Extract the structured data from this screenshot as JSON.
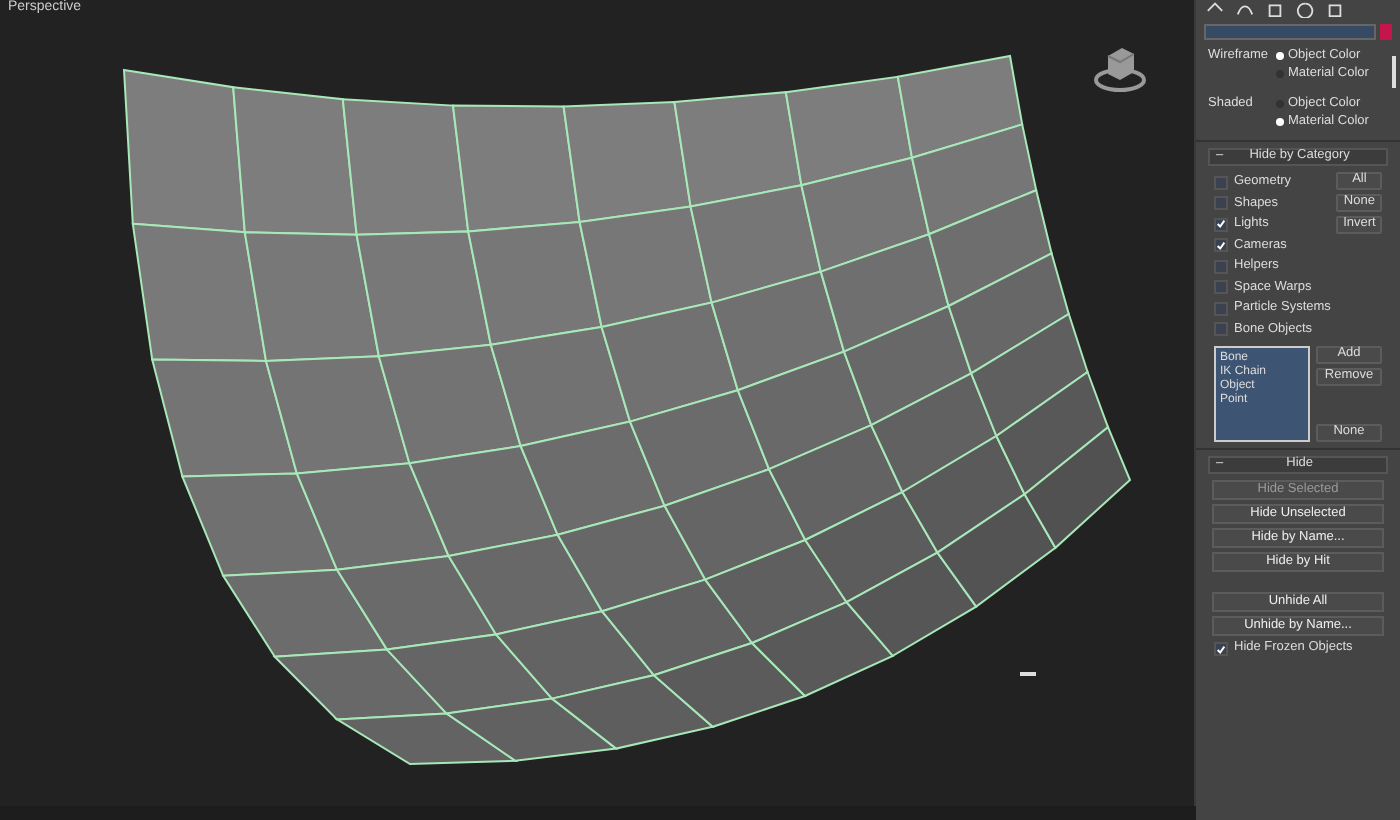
{
  "viewport": {
    "label": "Perspective"
  },
  "display_color": [
    {
      "label": "Wireframe",
      "options": [
        {
          "label": "Object Color",
          "selected": true
        },
        {
          "label": "Material Color",
          "selected": false
        }
      ]
    },
    {
      "label": "Shaded",
      "options": [
        {
          "label": "Object Color",
          "selected": false
        },
        {
          "label": "Material Color",
          "selected": true
        }
      ]
    }
  ],
  "hide_by_category": {
    "title": "Hide by Category",
    "toggle": "–",
    "categories": [
      {
        "label": "Geometry",
        "checked": false
      },
      {
        "label": "Shapes",
        "checked": false
      },
      {
        "label": "Lights",
        "checked": true
      },
      {
        "label": "Cameras",
        "checked": true
      },
      {
        "label": "Helpers",
        "checked": false
      },
      {
        "label": "Space Warps",
        "checked": false
      },
      {
        "label": "Particle Systems",
        "checked": false
      },
      {
        "label": "Bone Objects",
        "checked": false
      }
    ],
    "buttons": [
      "All",
      "None",
      "Invert"
    ],
    "list": [
      "Bone",
      "IK Chain Object",
      "Point"
    ],
    "list_buttons": [
      "Add",
      "Remove"
    ],
    "none_button": "None"
  },
  "hide": {
    "title": "Hide",
    "toggle": "–",
    "buttons": [
      {
        "label": "Hide Selected",
        "disabled": true
      },
      {
        "label": "Hide Unselected",
        "disabled": false
      },
      {
        "label": "Hide by Name...",
        "disabled": false
      },
      {
        "label": "Hide by Hit",
        "disabled": false
      },
      {
        "label": "Unhide All",
        "disabled": false
      },
      {
        "label": "Unhide by Name...",
        "disabled": false
      }
    ],
    "frozen": {
      "label": "Hide Frozen Objects",
      "checked": true
    }
  }
}
